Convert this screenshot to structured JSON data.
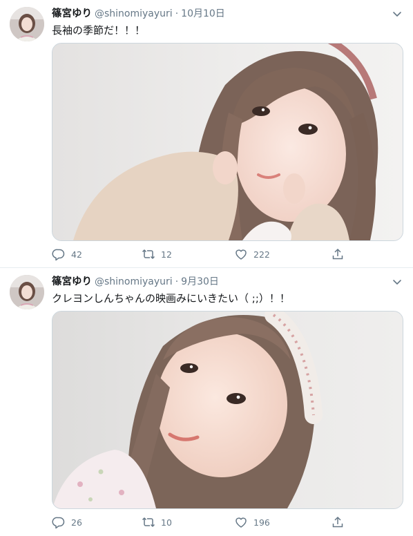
{
  "tweets": [
    {
      "user": {
        "display_name": "篠宮ゆり",
        "handle": "@shinomiyayuri"
      },
      "separator": "·",
      "date": "10月10日",
      "text": "長袖の季節だ！！！",
      "photo_icon": "selfie-photo",
      "stats": {
        "replies": "42",
        "retweets": "12",
        "likes": "222"
      }
    },
    {
      "user": {
        "display_name": "篠宮ゆり",
        "handle": "@shinomiyayuri"
      },
      "separator": "·",
      "date": "9月30日",
      "text": "クレヨンしんちゃんの映画みにいきたい（ ;;）！！",
      "photo_icon": "selfie-photo",
      "stats": {
        "replies": "26",
        "retweets": "10",
        "likes": "196"
      }
    }
  ],
  "icons": {
    "reply": "reply-icon",
    "retweet": "retweet-icon",
    "like": "heart-icon",
    "share": "share-icon",
    "more": "chevron-down-icon"
  },
  "colors": {
    "text_primary": "#14171a",
    "text_secondary": "#657786",
    "border": "#ccd6dd",
    "divider": "#e6ecf0"
  }
}
